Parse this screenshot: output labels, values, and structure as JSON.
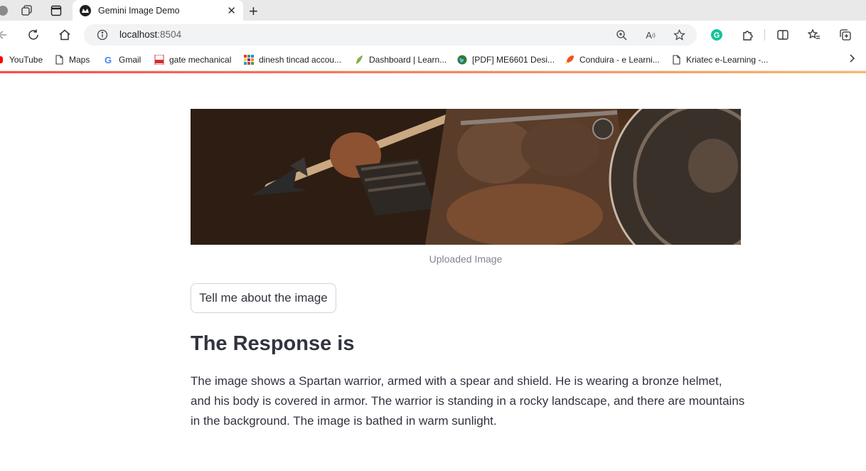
{
  "browser": {
    "tab": {
      "title": "Gemini Image Demo"
    },
    "address": {
      "host": "localhost",
      "port": ":8504"
    },
    "bookmarks": [
      {
        "label": "YouTube",
        "icon": "youtube-icon"
      },
      {
        "label": "Maps",
        "icon": "page-icon"
      },
      {
        "label": "Gmail",
        "icon": "google-icon"
      },
      {
        "label": "gate mechanical",
        "icon": "pdf-icon"
      },
      {
        "label": "dinesh tincad accou...",
        "icon": "grid-icon"
      },
      {
        "label": "Dashboard | Learn...",
        "icon": "leaf-icon"
      },
      {
        "label": "[PDF] ME6601 Desi...",
        "icon": "globe-icon"
      },
      {
        "label": "Conduira - e Learni...",
        "icon": "rocket-icon"
      },
      {
        "label": "Kriatec e-Learning -...",
        "icon": "page-icon"
      }
    ]
  },
  "app": {
    "image_caption": "Uploaded Image",
    "ask_button": "Tell me about the image",
    "response_heading": "The Response is",
    "response_text": "The image shows a Spartan warrior, armed with a spear and shield. He is wearing a bronze helmet, and his body is covered in armor. The warrior is standing in a rocky landscape, and there are mountains in the background. The image is bathed in warm sunlight."
  },
  "colors": {
    "accent": "#ff4b4b",
    "text": "#31333f",
    "caption": "#808495"
  }
}
